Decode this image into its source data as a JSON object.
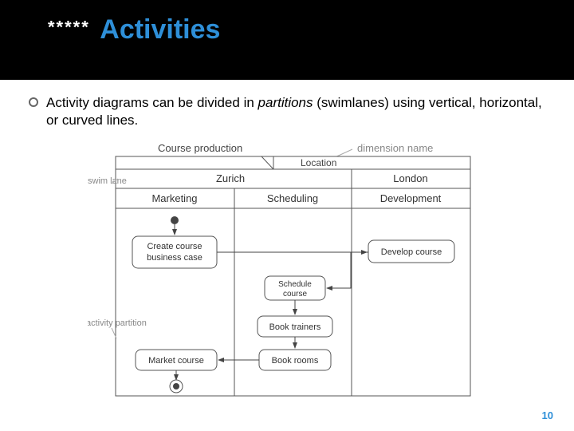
{
  "slide": {
    "stars": "*****",
    "title": "Activities",
    "body_pre": "Activity diagrams can be divided in ",
    "body_em": "partitions",
    "body_mid": " (swimlanes)",
    "body_post": " using vertical, horizontal, or curved lines.",
    "page": "10"
  },
  "diagram": {
    "diagram_name": "Course production",
    "dimension_name_label": "dimension name",
    "dimension_name": "Location",
    "column_groups": [
      {
        "label": "Zurich",
        "span": 2
      },
      {
        "label": "London",
        "span": 1
      }
    ],
    "columns": [
      "Marketing",
      "Scheduling",
      "Development"
    ],
    "row_labels": [
      "swim lane",
      "activity partition"
    ],
    "activities": {
      "create_case": "Create course business case",
      "develop": "Develop course",
      "schedule": "Schedule course",
      "book_trainers": "Book trainers",
      "market": "Market course",
      "book_rooms": "Book rooms"
    }
  }
}
